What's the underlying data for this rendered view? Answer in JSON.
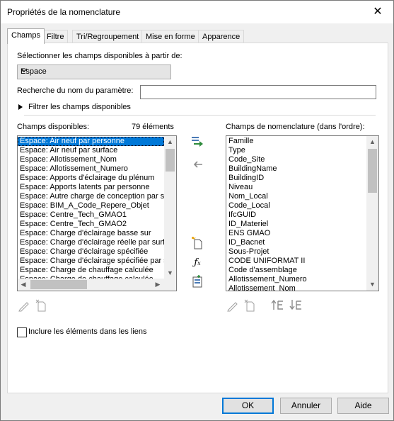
{
  "window": {
    "title": "Propriétés de la nomenclature",
    "close_glyph": "✕"
  },
  "tabs": [
    {
      "label": "Champs",
      "active": true
    },
    {
      "label": "Filtre",
      "active": false
    },
    {
      "label": "Tri/Regroupement",
      "active": false
    },
    {
      "label": "Mise en forme",
      "active": false
    },
    {
      "label": "Apparence",
      "active": false
    }
  ],
  "fields_tab": {
    "select_from_label": "Sélectionner les champs disponibles à partir de:",
    "select_from_value": "Espace",
    "search_label": "Recherche du nom du paramètre:",
    "search_value": "",
    "filter_expander_label": "Filtrer les champs disponibles",
    "available_label": "Champs disponibles:",
    "available_count": "79 éléments",
    "available_items": [
      "Espace: Air neuf par personne",
      "Espace: Air neuf par surface",
      "Espace: Allotissement_Nom",
      "Espace: Allotissement_Numero",
      "Espace: Apports d'éclairage du plénum",
      "Espace: Apports latents par personne",
      "Espace: Autre charge de conception par su",
      "Espace: BIM_A_Code_Repere_Objet",
      "Espace: Centre_Tech_GMAO1",
      "Espace: Centre_Tech_GMAO2",
      "Espace: Charge d'éclairage basse sur",
      "Espace: Charge d'éclairage réelle par surfa",
      "Espace: Charge d'éclairage spécifiée",
      "Espace: Charge d'éclairage spécifiée par su",
      "Espace: Charge de chauffage calculée",
      "Espace: Charge de chauffage calculée"
    ],
    "available_selected_index": 0,
    "schedule_label": "Champs de nomenclature (dans l'ordre):",
    "schedule_items": [
      "Famille",
      "Type",
      "Code_Site",
      "BuildingName",
      "BuildingID",
      "Niveau",
      "Nom_Local",
      "Code_Local",
      "IfcGUID",
      "ID_Materiel",
      "ENS GMAO",
      "ID_Bacnet",
      "Sous-Projet",
      "CODE UNIFORMAT II",
      "Code d'assemblage",
      "Allotissement_Numero",
      "Allotissement_Nom"
    ],
    "include_linked_label": "Inclure les éléments dans les liens",
    "include_linked_checked": false
  },
  "footer": {
    "ok": "OK",
    "cancel": "Annuler",
    "help": "Aide"
  },
  "colors": {
    "selection": "#0078d7",
    "add_arrow": "#2e8b3c",
    "default_button_border": "#0078d7"
  }
}
